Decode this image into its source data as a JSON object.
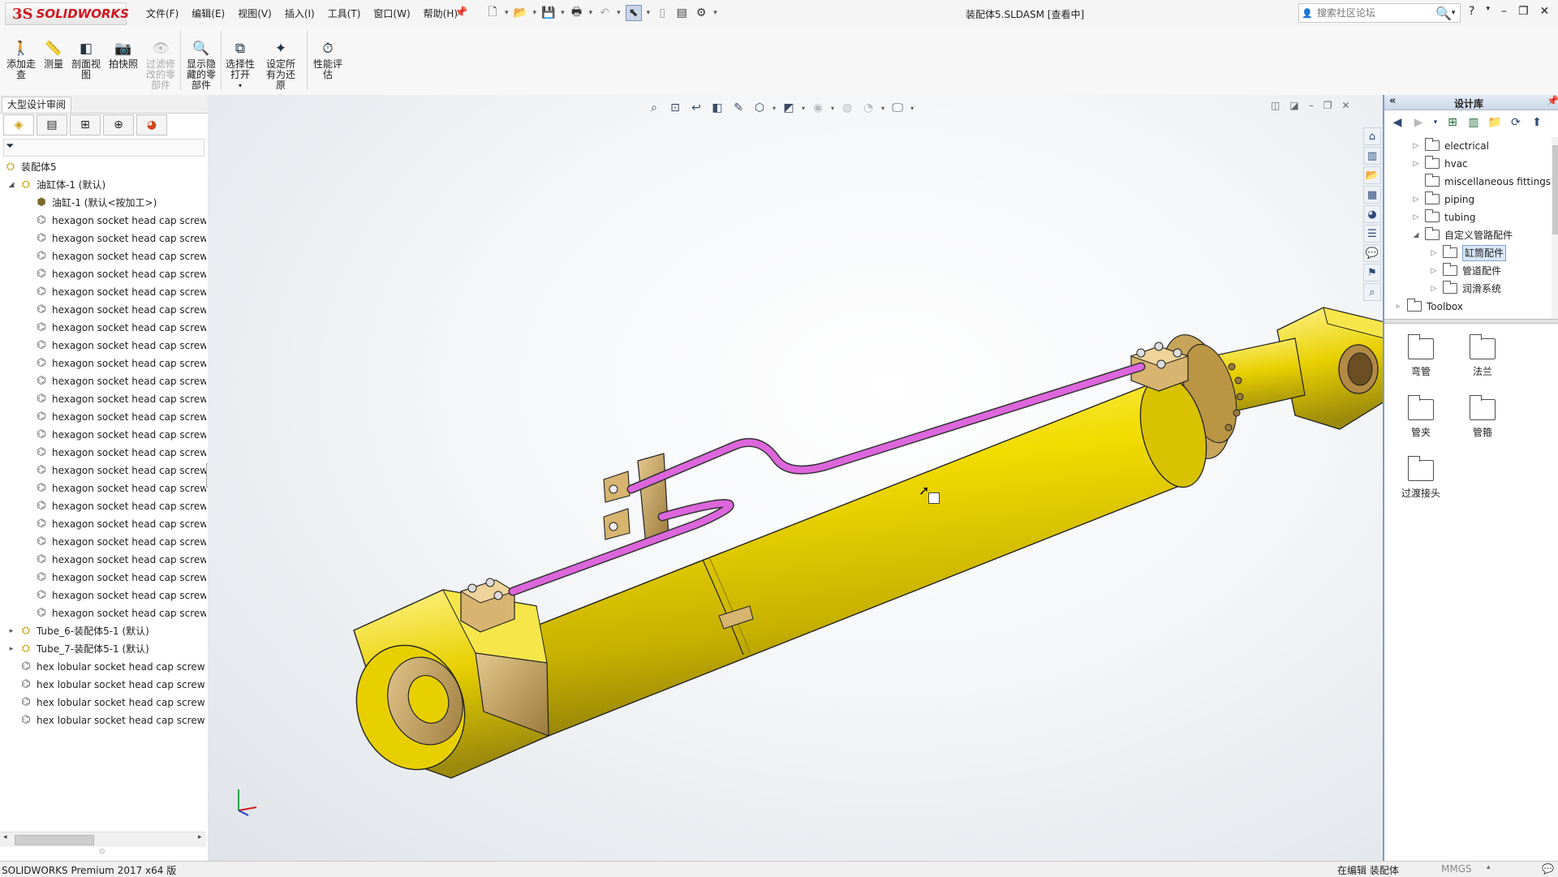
{
  "app": {
    "logo_ds": "3S",
    "brand": "SOLIDWORKS",
    "document_title": "装配体5.SLDASM [查看中]"
  },
  "menu": [
    "文件(F)",
    "编辑(E)",
    "视图(V)",
    "插入(I)",
    "工具(T)",
    "窗口(W)",
    "帮助(H)"
  ],
  "search": {
    "placeholder": "搜索社区论坛"
  },
  "ribbon": {
    "buttons": [
      {
        "label": "添加走查",
        "icon": "walkthrough-icon",
        "enabled": true
      },
      {
        "label": "测量",
        "icon": "measure-icon",
        "enabled": true
      },
      {
        "label": "剖面视图",
        "icon": "section-view-icon",
        "enabled": true
      },
      {
        "label": "拍快照",
        "icon": "snapshot-icon",
        "enabled": true
      },
      {
        "label": "过滤修改的零部件",
        "icon": "filter-modified-icon",
        "enabled": false
      },
      {
        "label": "显示隐藏的零部件",
        "icon": "show-hidden-icon",
        "enabled": true
      },
      {
        "label": "选择性打开",
        "icon": "selective-open-icon",
        "enabled": true
      },
      {
        "label": "设定所有为还原",
        "icon": "set-resolved-icon",
        "enabled": true
      },
      {
        "label": "性能评估",
        "icon": "performance-icon",
        "enabled": true
      }
    ]
  },
  "left_panel": {
    "tab_label": "大型设计审阅",
    "tree": [
      {
        "label": "装配体5",
        "level": 0,
        "icon": "assembly-icon",
        "toggle": ""
      },
      {
        "label": "油缸体-1 (默认)",
        "level": 1,
        "icon": "assembly-icon",
        "toggle": "◢"
      },
      {
        "label": "油缸-1 (默认<按加工>)",
        "level": 2,
        "icon": "part-icon",
        "toggle": ""
      },
      {
        "label": "hexagon socket head cap screw",
        "level": 2,
        "icon": "screw-icon",
        "toggle": ""
      },
      {
        "label": "hexagon socket head cap screw",
        "level": 2,
        "icon": "screw-icon",
        "toggle": ""
      },
      {
        "label": "hexagon socket head cap screw",
        "level": 2,
        "icon": "screw-icon",
        "toggle": ""
      },
      {
        "label": "hexagon socket head cap screw",
        "level": 2,
        "icon": "screw-icon",
        "toggle": ""
      },
      {
        "label": "hexagon socket head cap screw",
        "level": 2,
        "icon": "screw-icon",
        "toggle": ""
      },
      {
        "label": "hexagon socket head cap screw",
        "level": 2,
        "icon": "screw-icon",
        "toggle": ""
      },
      {
        "label": "hexagon socket head cap screw",
        "level": 2,
        "icon": "screw-icon",
        "toggle": ""
      },
      {
        "label": "hexagon socket head cap screw",
        "level": 2,
        "icon": "screw-icon",
        "toggle": ""
      },
      {
        "label": "hexagon socket head cap screw",
        "level": 2,
        "icon": "screw-icon",
        "toggle": ""
      },
      {
        "label": "hexagon socket head cap screw",
        "level": 2,
        "icon": "screw-icon",
        "toggle": ""
      },
      {
        "label": "hexagon socket head cap screw",
        "level": 2,
        "icon": "screw-icon",
        "toggle": ""
      },
      {
        "label": "hexagon socket head cap screw",
        "level": 2,
        "icon": "screw-icon",
        "toggle": ""
      },
      {
        "label": "hexagon socket head cap screw",
        "level": 2,
        "icon": "screw-icon",
        "toggle": ""
      },
      {
        "label": "hexagon socket head cap screw",
        "level": 2,
        "icon": "screw-icon",
        "toggle": ""
      },
      {
        "label": "hexagon socket head cap screw",
        "level": 2,
        "icon": "screw-icon",
        "toggle": ""
      },
      {
        "label": "hexagon socket head cap screw",
        "level": 2,
        "icon": "screw-icon",
        "toggle": ""
      },
      {
        "label": "hexagon socket head cap screw",
        "level": 2,
        "icon": "screw-icon",
        "toggle": ""
      },
      {
        "label": "hexagon socket head cap screw",
        "level": 2,
        "icon": "screw-icon",
        "toggle": ""
      },
      {
        "label": "hexagon socket head cap screw",
        "level": 2,
        "icon": "screw-icon",
        "toggle": ""
      },
      {
        "label": "hexagon socket head cap screw",
        "level": 2,
        "icon": "screw-icon",
        "toggle": ""
      },
      {
        "label": "hexagon socket head cap screw",
        "level": 2,
        "icon": "screw-icon",
        "toggle": ""
      },
      {
        "label": "hexagon socket head cap screw",
        "level": 2,
        "icon": "screw-icon",
        "toggle": ""
      },
      {
        "label": "hexagon socket head cap screw",
        "level": 2,
        "icon": "screw-icon",
        "toggle": ""
      },
      {
        "label": "Tube_6-装配体5-1 (默认)",
        "level": 1,
        "icon": "assembly-icon",
        "toggle": "▸"
      },
      {
        "label": "Tube_7-装配体5-1 (默认)",
        "level": 1,
        "icon": "assembly-icon",
        "toggle": "▸"
      },
      {
        "label": "hex lobular socket head cap screw",
        "level": 1,
        "icon": "screw-icon",
        "toggle": ""
      },
      {
        "label": "hex lobular socket head cap screw",
        "level": 1,
        "icon": "screw-icon",
        "toggle": ""
      },
      {
        "label": "hex lobular socket head cap screw",
        "level": 1,
        "icon": "screw-icon",
        "toggle": ""
      },
      {
        "label": "hex lobular socket head cap screw",
        "level": 1,
        "icon": "screw-icon",
        "toggle": ""
      }
    ]
  },
  "design_library": {
    "title": "设计库",
    "folders": [
      {
        "label": "electrical",
        "toggle": "▷",
        "level": 0,
        "selected": false
      },
      {
        "label": "hvac",
        "toggle": "▷",
        "level": 0,
        "selected": false
      },
      {
        "label": "miscellaneous fittings",
        "toggle": "",
        "level": 0,
        "selected": false
      },
      {
        "label": "piping",
        "toggle": "▷",
        "level": 0,
        "selected": false
      },
      {
        "label": "tubing",
        "toggle": "▷",
        "level": 0,
        "selected": false
      },
      {
        "label": "自定义管路配件",
        "toggle": "◢",
        "level": 0,
        "selected": false
      },
      {
        "label": "缸筒配件",
        "toggle": "▷",
        "level": 1,
        "selected": true
      },
      {
        "label": "管道配件",
        "toggle": "▷",
        "level": 1,
        "selected": false
      },
      {
        "label": "润滑系统",
        "toggle": "▷",
        "level": 1,
        "selected": false
      },
      {
        "label": "Toolbox",
        "toggle": "▹",
        "level": -1,
        "selected": false
      }
    ],
    "files": [
      "弯管",
      "法兰",
      "管夹",
      "管箍",
      "过渡接头"
    ]
  },
  "status": {
    "product": "SOLIDWORKS Premium 2017 x64 版",
    "editing": "在编辑 装配体",
    "units": "MMGS"
  },
  "colors": {
    "cylinder": "#e8d000",
    "cylinder_dark": "#8a7a12",
    "bronze": "#c6a464",
    "pipe": "#dd66dd",
    "accent": "#d0171f"
  }
}
